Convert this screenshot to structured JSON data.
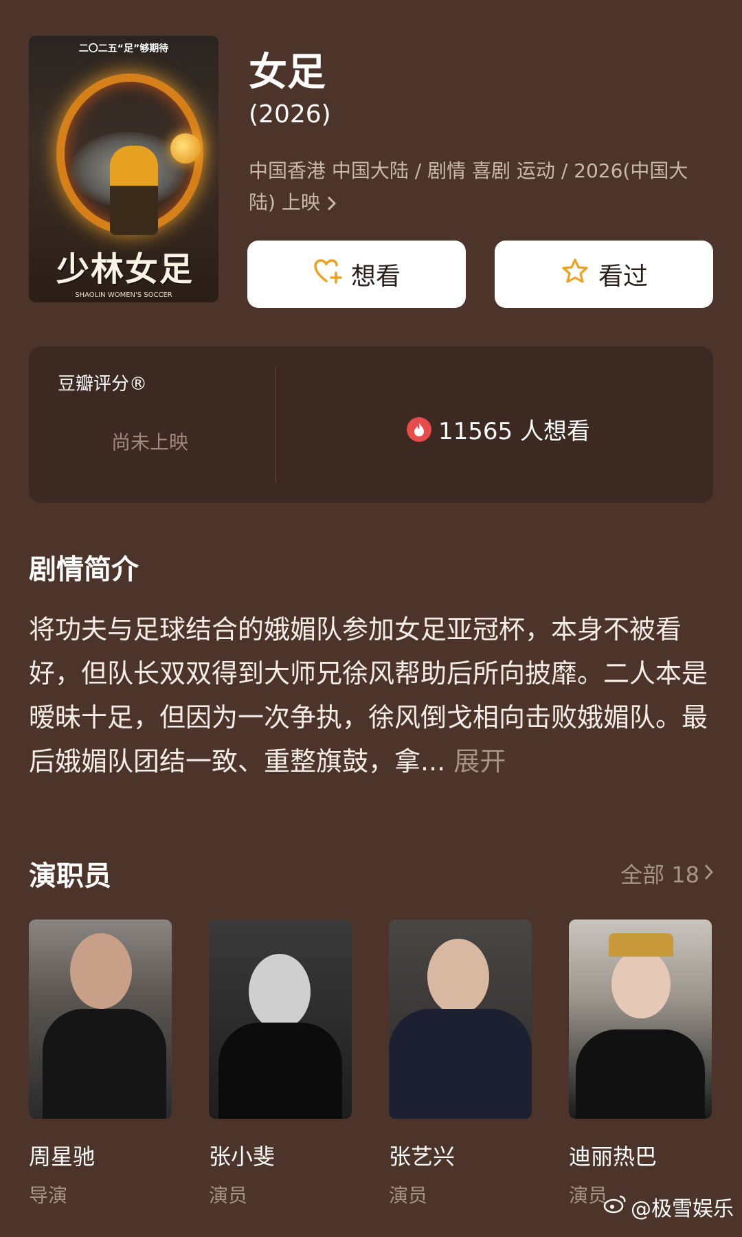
{
  "poster": {
    "top_text": "二〇二五“足”够期待",
    "logo_text": "少林女足",
    "sub_text": "SHAOLIN WOMEN'S SOCCER"
  },
  "movie": {
    "title": "女足",
    "year": "(2026)",
    "meta_line": "中国香港 中国大陆 / 剧情 喜剧 运动 / 2026(中国大陆) 上映"
  },
  "actions": {
    "want_label": "想看",
    "seen_label": "看过"
  },
  "rating": {
    "label": "豆瓣评分®",
    "status": "尚未上映",
    "want_count": "11565 人想看"
  },
  "plot": {
    "title": "剧情简介",
    "text": "将功夫与足球结合的娥媚队参加女足亚冠杯，本身不被看好，但队长双双得到大师兄徐风帮助后所向披靡。二人本是暧昧十足，但因为一次争执，徐风倒戈相向击败娥媚队。最后娥媚队团结一致、重整旗鼓，拿...",
    "expand_label": "展开"
  },
  "cast": {
    "title": "演职员",
    "all_label": "全部 18",
    "members": [
      {
        "name": "周星驰",
        "role": "导演"
      },
      {
        "name": "张小斐",
        "role": "演员"
      },
      {
        "name": "张艺兴",
        "role": "演员"
      },
      {
        "name": "迪丽热巴",
        "role": "演员"
      }
    ]
  },
  "watermark": "@极雪娱乐",
  "colors": {
    "background": "#4c342a",
    "card": "#3b2922",
    "accent_orange": "#f0a020",
    "fire_red": "#e74c4c"
  }
}
